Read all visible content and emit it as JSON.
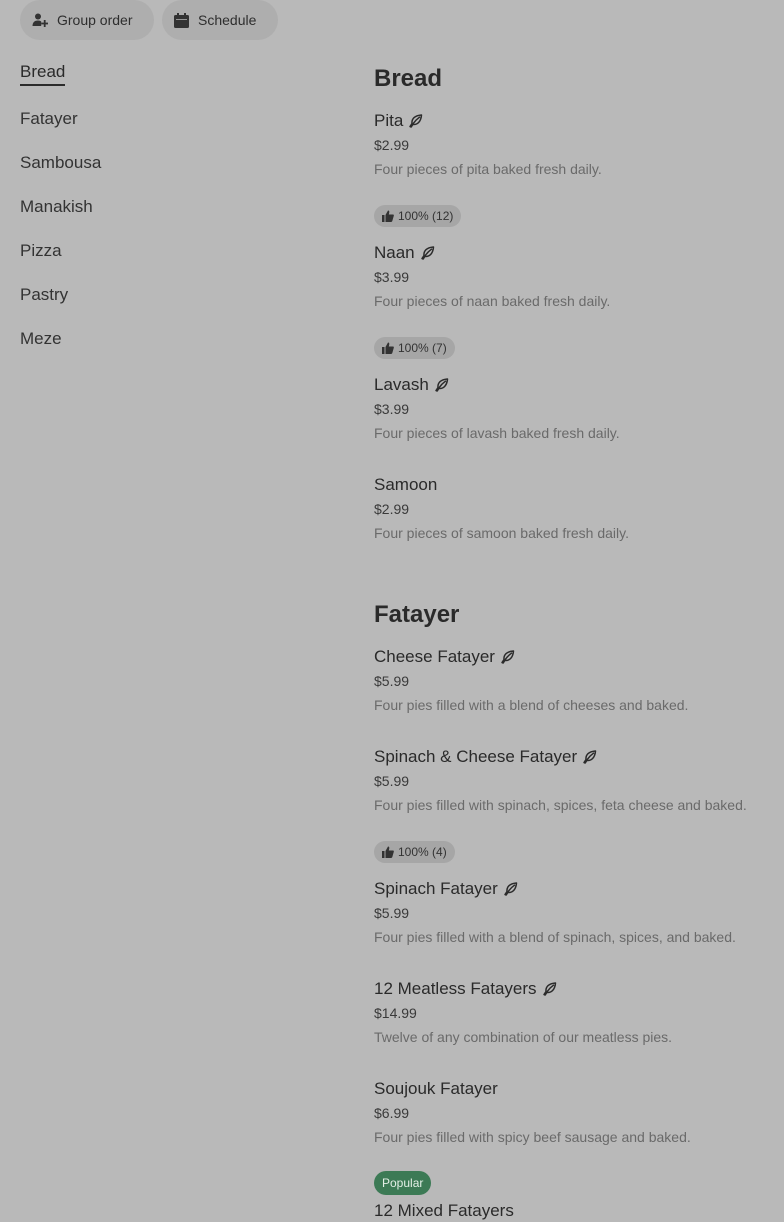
{
  "header": {
    "group_order": "Group order",
    "schedule": "Schedule"
  },
  "categories": [
    "Bread",
    "Fatayer",
    "Sambousa",
    "Manakish",
    "Pizza",
    "Pastry",
    "Meze"
  ],
  "sections": [
    {
      "title": "Bread",
      "items": [
        {
          "name": "Pita",
          "price": "$2.99",
          "desc": "Four pieces of pita baked fresh daily.",
          "vegetarian": true,
          "rating": "100% (12)"
        },
        {
          "name": "Naan",
          "price": "$3.99",
          "desc": "Four pieces of naan baked fresh daily.",
          "vegetarian": true,
          "rating": "100% (7)"
        },
        {
          "name": "Lavash",
          "price": "$3.99",
          "desc": "Four pieces of lavash baked fresh daily.",
          "vegetarian": true
        },
        {
          "name": "Samoon",
          "price": "$2.99",
          "desc": "Four pieces of samoon baked fresh daily."
        }
      ]
    },
    {
      "title": "Fatayer",
      "items": [
        {
          "name": "Cheese Fatayer",
          "price": "$5.99",
          "desc": "Four pies filled with a blend of cheeses and baked.",
          "vegetarian": true
        },
        {
          "name": "Spinach & Cheese Fatayer",
          "price": "$5.99",
          "desc": "Four pies filled with spinach, spices, feta cheese and baked.",
          "vegetarian": true,
          "rating": "100% (4)"
        },
        {
          "name": "Spinach Fatayer",
          "price": "$5.99",
          "desc": "Four pies filled with a blend of spinach, spices, and baked.",
          "vegetarian": true
        },
        {
          "name": "12 Meatless Fatayers",
          "price": "$14.99",
          "desc": "Twelve of any combination of our meatless pies.",
          "vegetarian": true
        },
        {
          "name": "Soujouk Fatayer",
          "price": "$6.99",
          "desc": "Four pies filled with spicy beef sausage and baked.",
          "tag": "Popular"
        },
        {
          "name": "12 Mixed Fatayers"
        }
      ]
    }
  ]
}
